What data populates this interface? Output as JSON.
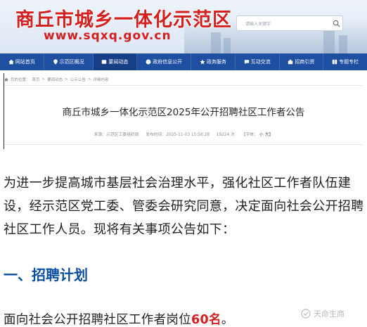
{
  "site": {
    "title": "商丘市城乡一体化示范区",
    "url": "www.sqxq.gov.cn",
    "search_placeholder": "请输入关键字"
  },
  "nav": [
    {
      "label": "网站首页",
      "icon": "home-icon"
    },
    {
      "label": "示范区概况",
      "icon": "location-icon"
    },
    {
      "label": "要闻动态",
      "icon": "news-icon"
    },
    {
      "label": "政府信息公开",
      "icon": "info-icon"
    },
    {
      "label": "政务服务",
      "icon": "service-icon"
    },
    {
      "label": "互动交流",
      "icon": "chat-icon"
    },
    {
      "label": "招商引资",
      "icon": "investment-icon"
    },
    {
      "label": "专题专栏",
      "icon": "column-icon"
    }
  ],
  "breadcrumb": {
    "prefix": "您的位置：",
    "items": [
      "首页",
      "要闻动态",
      "公示公告",
      "详细内容"
    ],
    "separator": ">"
  },
  "article": {
    "title": "商丘市城乡一体化示范区2025年公开招聘社区工作者公告",
    "meta": {
      "source": "来源：示范区工委组织部",
      "published": "发布时间：2025-11-03 15:58:28",
      "views": "19224 次",
      "font_label": "【字体：",
      "font_small": "小",
      "font_large": "大】"
    }
  },
  "body": {
    "intro": "为进一步提高城市基层社会治理水平，强化社区工作者队伍建设，经示范区党工委、管委会研究同意，决定面向社会公开招聘社区工作人员。现将有关事项公告如下：",
    "section1_heading": "一、招聘计划",
    "last_line_prefix": "面向社会公开招聘社区工作者岗位",
    "last_line_number": "60名",
    "last_line_suffix": "。"
  },
  "watermark": {
    "text": "天命生商",
    "icon": "watermark-logo-icon"
  }
}
